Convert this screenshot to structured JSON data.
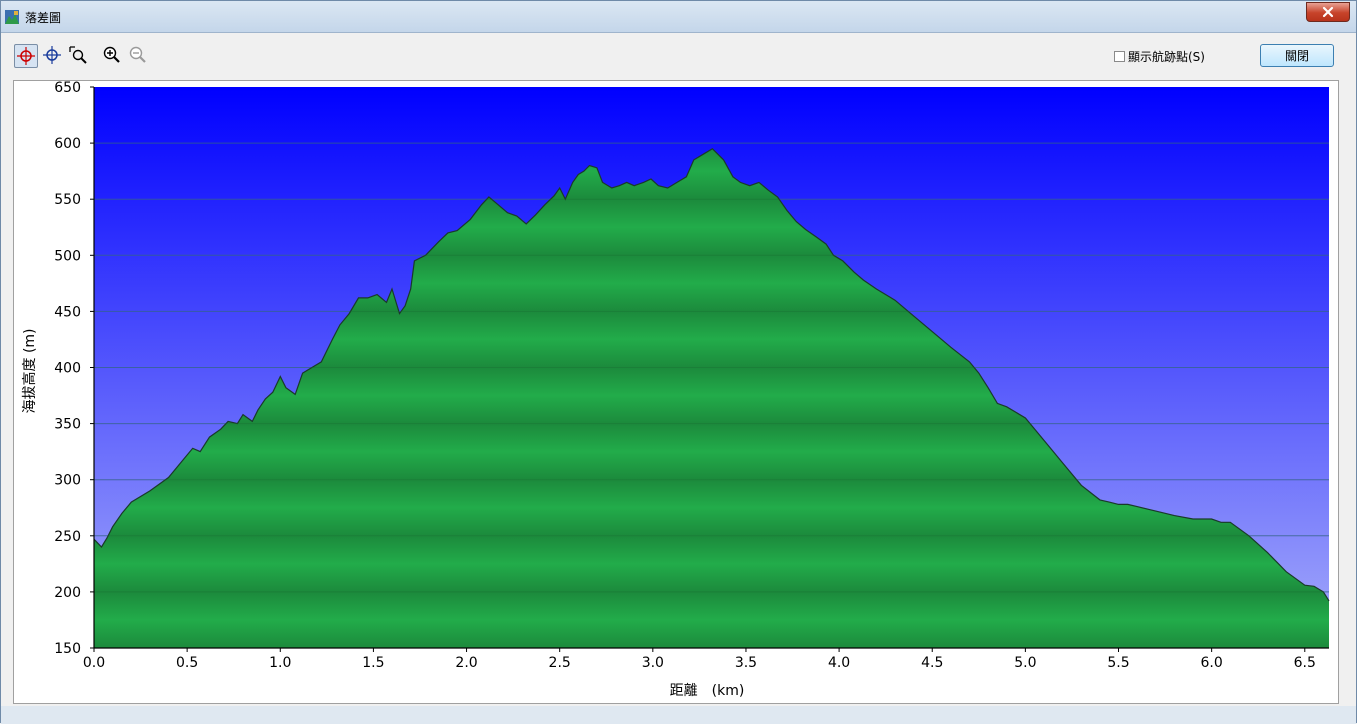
{
  "window": {
    "title": "落差圖"
  },
  "toolbar": {
    "icons": [
      "crosshair-red-icon",
      "crosshair-blue-icon",
      "zoom-region-icon",
      "zoom-in-icon",
      "zoom-out-icon"
    ],
    "show_track_points_label": "顯示航跡點(S)",
    "show_track_points_checked": false,
    "close_label": "關閉"
  },
  "colors": {
    "sky_top": "#0000ff",
    "sky_bottom": "#a6acfa",
    "terrain_dark": "#1c8a3c",
    "terrain_light": "#22ac4a",
    "outline": "#1a3a2a"
  },
  "chart_data": {
    "type": "area",
    "xlabel": "距離　(km)",
    "ylabel": "海拔高度 (m)",
    "xlim": [
      0,
      6.63
    ],
    "ylim": [
      150,
      650
    ],
    "xticks": [
      "0.0",
      "0.5",
      "1.0",
      "1.5",
      "2.0",
      "2.5",
      "3.0",
      "3.5",
      "4.0",
      "4.5",
      "5.0",
      "5.5",
      "6.0",
      "6.5"
    ],
    "yticks": [
      "150",
      "200",
      "250",
      "300",
      "350",
      "400",
      "450",
      "500",
      "550",
      "600",
      "650"
    ],
    "grid": true,
    "series": [
      {
        "x": [
          0.0,
          0.04,
          0.07,
          0.1,
          0.15,
          0.2,
          0.3,
          0.4,
          0.48,
          0.53,
          0.57,
          0.62,
          0.68,
          0.72,
          0.77,
          0.8,
          0.85,
          0.88,
          0.92,
          0.96,
          1.0,
          1.03,
          1.08,
          1.12,
          1.17,
          1.22,
          1.28,
          1.32,
          1.37,
          1.42,
          1.47,
          1.52,
          1.57,
          1.6,
          1.64,
          1.67,
          1.7,
          1.72,
          1.78,
          1.85,
          1.9,
          1.95,
          2.02,
          2.08,
          2.12,
          2.17,
          2.22,
          2.27,
          2.32,
          2.37,
          2.42,
          2.47,
          2.5,
          2.53,
          2.57,
          2.6,
          2.63,
          2.66,
          2.7,
          2.73,
          2.78,
          2.82,
          2.86,
          2.9,
          2.95,
          2.99,
          3.03,
          3.08,
          3.13,
          3.18,
          3.22,
          3.27,
          3.32,
          3.38,
          3.43,
          3.47,
          3.52,
          3.57,
          3.62,
          3.67,
          3.72,
          3.77,
          3.82,
          3.88,
          3.93,
          3.97,
          4.02,
          4.08,
          4.13,
          4.2,
          4.3,
          4.4,
          4.5,
          4.6,
          4.7,
          4.75,
          4.8,
          4.85,
          4.9,
          5.0,
          5.1,
          5.2,
          5.3,
          5.4,
          5.45,
          5.5,
          5.55,
          5.6,
          5.7,
          5.8,
          5.9,
          6.0,
          6.05,
          6.1,
          6.2,
          6.3,
          6.4,
          6.5,
          6.55,
          6.6,
          6.63
        ],
        "y": [
          247,
          240,
          248,
          258,
          270,
          280,
          290,
          302,
          318,
          328,
          325,
          338,
          345,
          352,
          350,
          358,
          352,
          362,
          372,
          378,
          392,
          382,
          376,
          395,
          400,
          405,
          425,
          438,
          448,
          462,
          462,
          465,
          458,
          470,
          448,
          455,
          470,
          495,
          500,
          512,
          520,
          522,
          532,
          545,
          552,
          545,
          538,
          535,
          528,
          536,
          545,
          553,
          560,
          550,
          565,
          572,
          575,
          580,
          578,
          565,
          560,
          562,
          565,
          562,
          565,
          568,
          562,
          560,
          565,
          570,
          585,
          590,
          595,
          585,
          570,
          565,
          562,
          565,
          558,
          552,
          540,
          530,
          523,
          516,
          510,
          500,
          495,
          485,
          478,
          470,
          460,
          446,
          432,
          418,
          405,
          395,
          382,
          368,
          365,
          355,
          335,
          315,
          295,
          282,
          280,
          278,
          278,
          276,
          272,
          268,
          265,
          265,
          262,
          262,
          250,
          235,
          218,
          206,
          205,
          200,
          192
        ]
      }
    ]
  }
}
